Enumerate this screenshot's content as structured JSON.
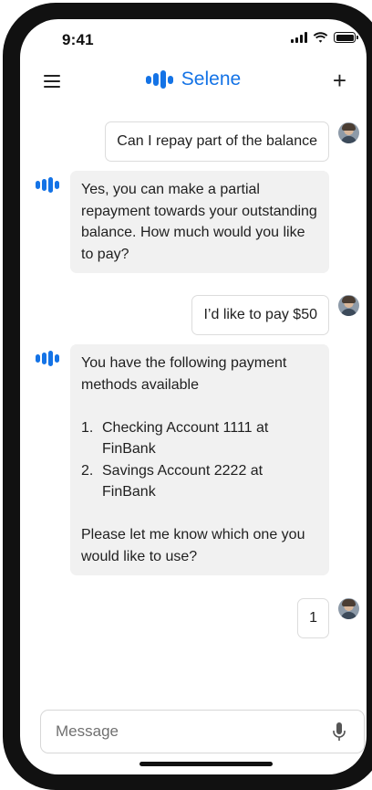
{
  "status_bar": {
    "time": "9:41"
  },
  "header": {
    "app_name": "Selene"
  },
  "messages": [
    {
      "from": "user",
      "text": "Can I repay part of the balance"
    },
    {
      "from": "bot",
      "text": "Yes, you can make a partial repayment towards your outstanding balance. How much would you like to pay?"
    },
    {
      "from": "user",
      "text": "I’d like to pay $50"
    },
    {
      "from": "bot",
      "intro": "You have the following payment methods available",
      "options": [
        {
          "num": "1.",
          "label": "Checking Account 1111 at FinBank"
        },
        {
          "num": "2.",
          "label": "Savings Account 2222 at FinBank"
        }
      ],
      "outro": "Please let me know which one you would like to use?"
    },
    {
      "from": "user",
      "text": "1"
    }
  ],
  "composer": {
    "placeholder": "Message"
  },
  "colors": {
    "brand": "#1473e6",
    "bot_bubble": "#f1f1f1",
    "user_bubble_border": "#dcdcdc"
  },
  "icons": {
    "menu": "hamburger-icon",
    "new_chat": "plus-icon",
    "mic": "microphone-icon",
    "bot": "selene-logo-icon",
    "user": "user-avatar"
  }
}
